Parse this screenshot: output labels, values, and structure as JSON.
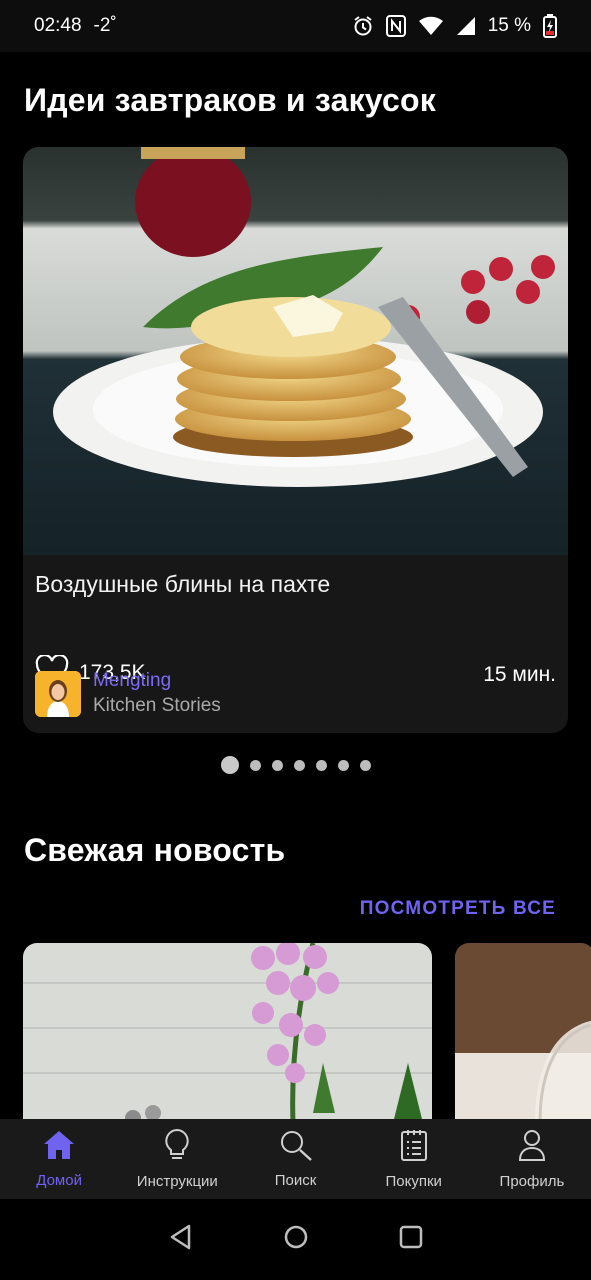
{
  "status_bar": {
    "time": "02:48",
    "temperature": "-2˚",
    "battery": "15 %",
    "icons": [
      "alarm-icon",
      "nfc-icon",
      "wifi-icon",
      "signal-icon",
      "battery-charging-icon"
    ]
  },
  "sections": {
    "breakfast_title": "Идеи завтраков и закусок",
    "news_title": "Свежая новость",
    "see_all": "ПОСМОТРЕТЬ ВСЕ"
  },
  "recipe_card": {
    "likes": "173,5K",
    "duration": "15 мин.",
    "title": "Воздушные блины на пахте",
    "author_name": "Mengting",
    "author_company": "Kitchen Stories"
  },
  "pager": {
    "count": 7,
    "active_index": 0
  },
  "bottom_nav": {
    "items": [
      {
        "label": "Домой",
        "icon": "home-icon",
        "active": true
      },
      {
        "label": "Инструкции",
        "icon": "lightbulb-icon",
        "active": false
      },
      {
        "label": "Поиск",
        "icon": "search-icon",
        "active": false
      },
      {
        "label": "Покупки",
        "icon": "shopping-list-icon",
        "active": false
      },
      {
        "label": "Профиль",
        "icon": "profile-icon",
        "active": false
      }
    ]
  },
  "colors": {
    "accent": "#6f63f0",
    "author_name": "#7b6cf6",
    "card_bg": "#171717",
    "nav_bg": "#1a1a1a"
  }
}
